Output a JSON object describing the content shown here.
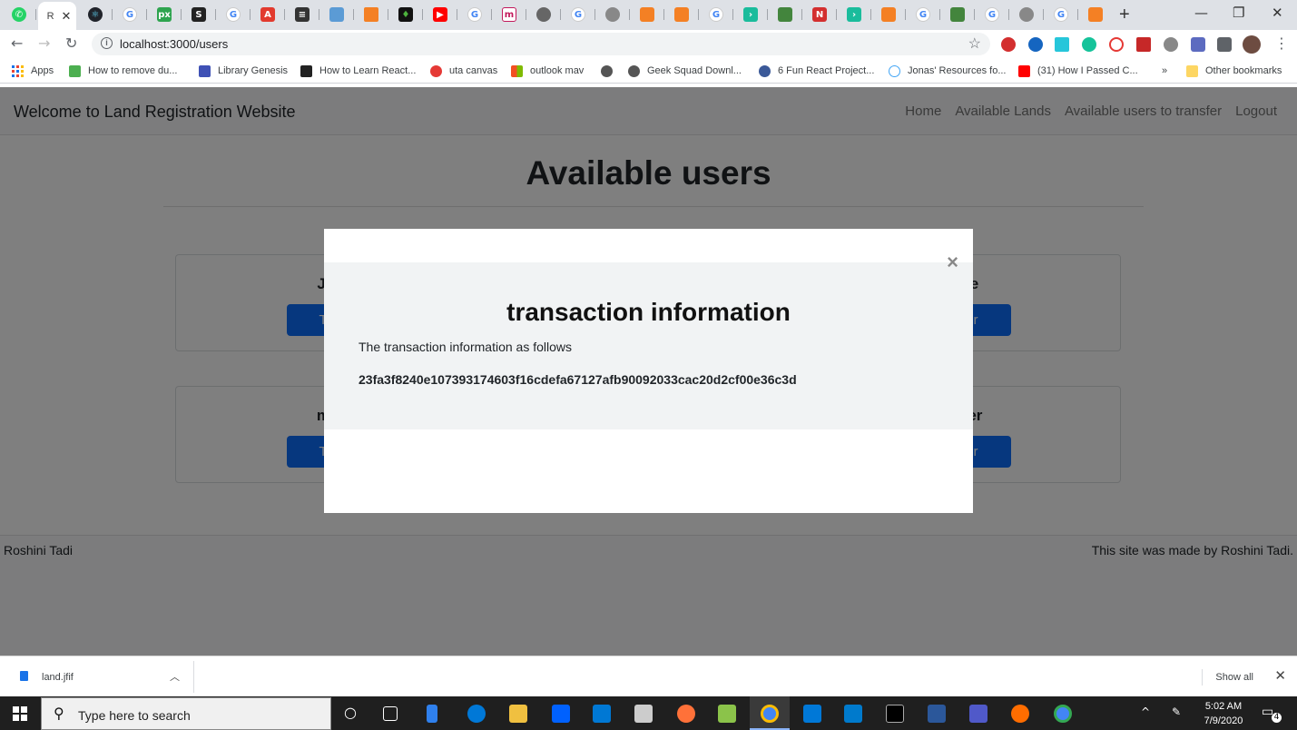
{
  "browser": {
    "active_tab_title": "R",
    "url": "localhost:3000/users",
    "bookmarks": [
      {
        "label": "Apps",
        "icon": "apps-grid-icon"
      },
      {
        "label": "How to remove du...",
        "icon": "w3-icon"
      },
      {
        "label": "Library Genesis",
        "icon": "library-icon"
      },
      {
        "label": "How to Learn React...",
        "icon": "react-icon"
      },
      {
        "label": "uta canvas",
        "icon": "canvas-icon"
      },
      {
        "label": "outlook mav",
        "icon": "microsoft-icon"
      },
      {
        "label": "",
        "icon": "globe-icon"
      },
      {
        "label": "Geek Squad Downl...",
        "icon": "globe-icon"
      },
      {
        "label": "6 Fun React Project...",
        "icon": "dev-icon"
      },
      {
        "label": "Jonas' Resources fo...",
        "icon": "heart-icon"
      },
      {
        "label": "(31) How I Passed C...",
        "icon": "youtube-icon"
      },
      {
        "label": "»",
        "icon": ""
      },
      {
        "label": "Other bookmarks",
        "icon": "folder-icon"
      }
    ]
  },
  "site": {
    "brand": "Welcome to Land Registration Website",
    "nav": [
      "Home",
      "Available Lands",
      "Available users to transfer",
      "Logout"
    ],
    "heading": "Available users",
    "cards": [
      {
        "name": "Jan",
        "button": "Trar"
      },
      {
        "name": "eve",
        "button": "sfer"
      },
      {
        "name": "mat",
        "button": "Trar"
      },
      {
        "name": "nifer",
        "button": "sfer"
      }
    ],
    "footer_left": "Roshini Tadi",
    "footer_right": "This site was made by Roshini Tadi."
  },
  "modal": {
    "close": "×",
    "title": "transaction information",
    "text": "The transaction information as follows",
    "hash": "23fa3f8240e107393174603f16cdefa67127afb90092033cac20d2cf00e36c3d"
  },
  "download": {
    "filename": "land.jfif",
    "show_all": "Show all"
  },
  "taskbar": {
    "search_placeholder": "Type here to search",
    "time": "5:02 AM",
    "date": "7/9/2020",
    "notification_count": "4"
  },
  "colors": {
    "primary_button": "#0d6efd",
    "backdrop": "rgba(0,0,0,0.5)"
  }
}
